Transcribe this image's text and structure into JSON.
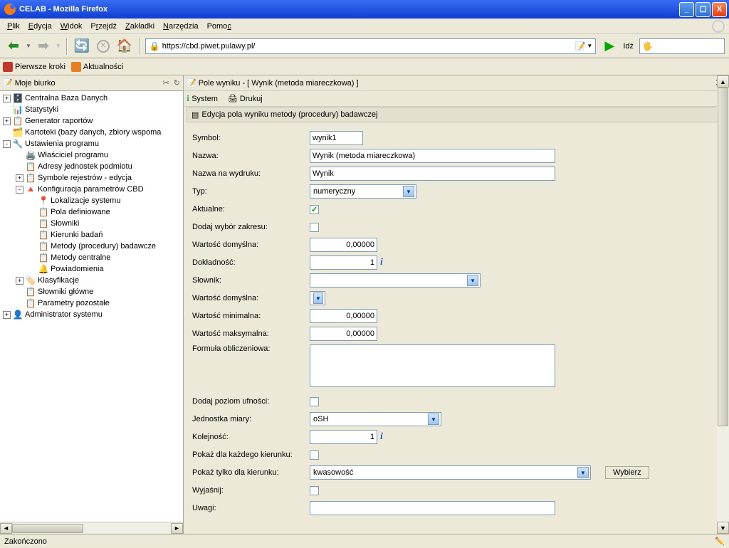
{
  "title": "CELAB - Mozilla Firefox",
  "menu": [
    "Plik",
    "Edycja",
    "Widok",
    "Przejdź",
    "Zakładki",
    "Narzędzia",
    "Pomoc"
  ],
  "url": "https://cbd.piwet.pulawy.pl/",
  "go_label": "Idź",
  "bookmarks": [
    "Pierwsze kroki",
    "Aktualności"
  ],
  "sidebar_title": "Moje biurko",
  "tree": [
    {
      "indent": 0,
      "exp": "+",
      "icon": "🗄️",
      "label": "Centralna Baza Danych"
    },
    {
      "indent": 0,
      "exp": "",
      "icon": "📊",
      "label": "Statystyki"
    },
    {
      "indent": 0,
      "exp": "+",
      "icon": "📋",
      "label": "Generator raportów"
    },
    {
      "indent": 0,
      "exp": "",
      "icon": "🗂️",
      "label": "Kartoteki (bazy danych, zbiory wspoma"
    },
    {
      "indent": 0,
      "exp": "-",
      "icon": "🔧",
      "label": "Ustawienia programu"
    },
    {
      "indent": 1,
      "exp": "",
      "icon": "🖨️",
      "label": "Właściciel programu"
    },
    {
      "indent": 1,
      "exp": "",
      "icon": "📋",
      "label": "Adresy jednostek podmiotu"
    },
    {
      "indent": 1,
      "exp": "+",
      "icon": "📋",
      "label": "Symbole rejestrów - edycja"
    },
    {
      "indent": 1,
      "exp": "-",
      "icon": "🔺",
      "label": "Konfiguracja parametrów CBD"
    },
    {
      "indent": 2,
      "exp": "",
      "icon": "📍",
      "label": "Lokalizacje systemu"
    },
    {
      "indent": 2,
      "exp": "",
      "icon": "📋",
      "label": "Pola definiowane"
    },
    {
      "indent": 2,
      "exp": "",
      "icon": "📋",
      "label": "Słowniki"
    },
    {
      "indent": 2,
      "exp": "",
      "icon": "📋",
      "label": "Kierunki badań"
    },
    {
      "indent": 2,
      "exp": "",
      "icon": "📋",
      "label": "Metody (procedury) badawcze"
    },
    {
      "indent": 2,
      "exp": "",
      "icon": "📋",
      "label": "Metody centralne"
    },
    {
      "indent": 2,
      "exp": "",
      "icon": "🔔",
      "label": "Powiadomienia"
    },
    {
      "indent": 1,
      "exp": "+",
      "icon": "🏷️",
      "label": "Klasyfikacje"
    },
    {
      "indent": 1,
      "exp": "",
      "icon": "📋",
      "label": "Słowniki główne"
    },
    {
      "indent": 1,
      "exp": "",
      "icon": "📋",
      "label": "Parametry pozostałe"
    },
    {
      "indent": 0,
      "exp": "+",
      "icon": "👤",
      "label": "Administrator systemu"
    }
  ],
  "content_title": "Pole wyniku - [ Wynik (metoda miareczkowa) ]",
  "content_menu": {
    "system": "System",
    "drukuj": "Drukuj"
  },
  "subsection": "Edycja pola wyniku metody (procedury) badawczej",
  "form": {
    "symbol": {
      "label": "Symbol:",
      "value": "wynik1"
    },
    "nazwa": {
      "label": "Nazwa:",
      "value": "Wynik (metoda miareczkowa)"
    },
    "nazwa_wydruk": {
      "label": "Nazwa na wydruku:",
      "value": "Wynik"
    },
    "typ": {
      "label": "Typ:",
      "value": "numeryczny"
    },
    "aktualne": {
      "label": "Aktualne:",
      "checked": true
    },
    "dodaj_zakres": {
      "label": "Dodaj wybór zakresu:",
      "checked": false
    },
    "wart_dom": {
      "label": "Wartość domyślna:",
      "value": "0,00000"
    },
    "dokladnosc": {
      "label": "Dokładność:",
      "value": "1"
    },
    "slownik": {
      "label": "Słownik:",
      "value": ""
    },
    "wart_dom2": {
      "label": "Wartość domyślna:",
      "value": ""
    },
    "wart_min": {
      "label": "Wartość minimalna:",
      "value": "0,00000"
    },
    "wart_max": {
      "label": "Wartość maksymalna:",
      "value": "0,00000"
    },
    "formula": {
      "label": "Formuła obliczeniowa:",
      "value": ""
    },
    "poziom_ufn": {
      "label": "Dodaj poziom ufności:",
      "checked": false
    },
    "jednostka": {
      "label": "Jednostka miary:",
      "value": "oSH"
    },
    "kolejnosc": {
      "label": "Kolejność:",
      "value": "1"
    },
    "kazdy_kier": {
      "label": "Pokaż dla każdego kierunku:",
      "checked": false
    },
    "tylko_kier": {
      "label": "Pokaż tylko dla kierunku:",
      "value": "kwasowość"
    },
    "wyjasnij": {
      "label": "Wyjaśnij:",
      "checked": false
    },
    "uwagi": {
      "label": "Uwagi:",
      "value": ""
    }
  },
  "wybierz_btn": "Wybierz",
  "status": "Zakończono"
}
